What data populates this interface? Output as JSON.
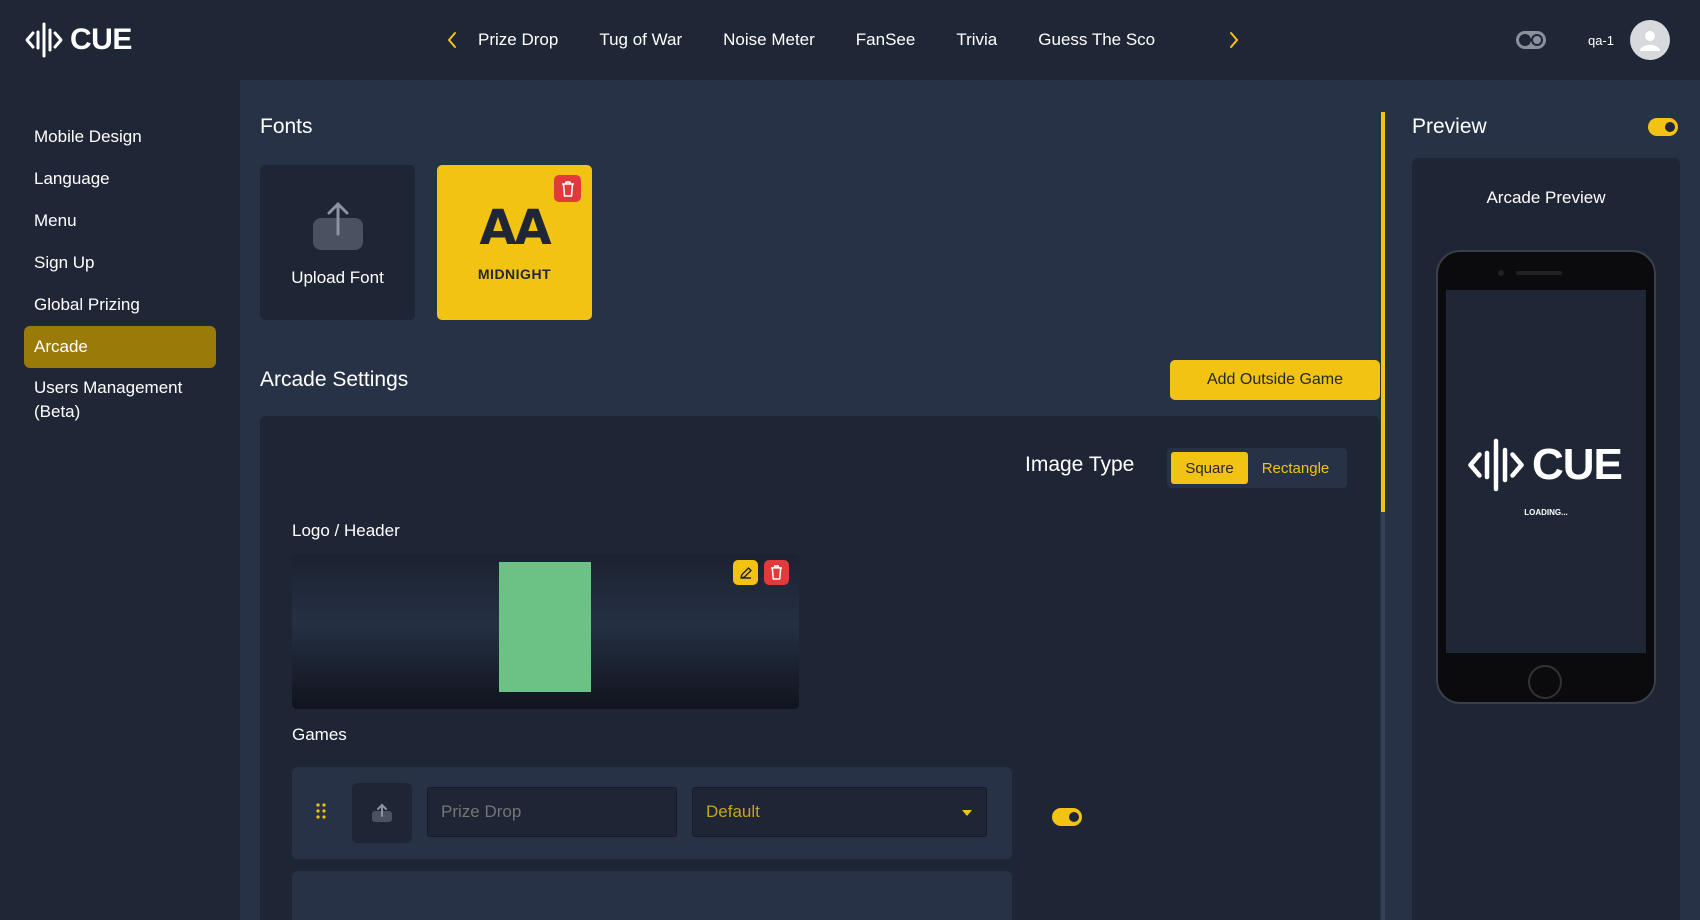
{
  "brand": {
    "name": "CUE"
  },
  "nav": {
    "items": [
      "Prize Drop",
      "Tug of War",
      "Noise Meter",
      "FanSee",
      "Trivia",
      "Guess The Sco"
    ]
  },
  "user": {
    "name": "qa-1"
  },
  "sidebar": {
    "items": [
      {
        "label": "Mobile Design",
        "active": false
      },
      {
        "label": "Language",
        "active": false
      },
      {
        "label": "Menu",
        "active": false
      },
      {
        "label": "Sign Up",
        "active": false
      },
      {
        "label": "Global Prizing",
        "active": false
      },
      {
        "label": "Arcade",
        "active": true
      },
      {
        "label": "Users Management",
        "label2": "(Beta)",
        "active": false
      }
    ]
  },
  "fonts": {
    "title": "Fonts",
    "upload_label": "Upload Font",
    "font_card": {
      "glyph": "AA",
      "name": "MIDNIGHT"
    }
  },
  "arcade": {
    "title": "Arcade Settings",
    "add_button": "Add Outside Game",
    "image_type_label": "Image Type",
    "image_type_options": [
      "Square",
      "Rectangle"
    ],
    "image_type_selected": "Square",
    "logo_header_label": "Logo / Header",
    "games_label": "Games",
    "games": [
      {
        "name_placeholder": "Prize Drop",
        "select_value": "Default",
        "enabled": true
      }
    ]
  },
  "preview": {
    "title": "Preview",
    "enabled": true,
    "name": "Arcade Preview",
    "phone_logo": "CUE",
    "loading_text": "LOADING..."
  },
  "colors": {
    "accent": "#f2c312",
    "background": "#1f2636",
    "panel": "#283246",
    "card": "#1e2534",
    "danger": "#e23a3a",
    "active_sidebar": "#9a7a08",
    "image_placeholder": "#6cc184"
  },
  "icons": [
    "cue-logo-icon",
    "chevron-left-icon",
    "chevron-right-icon",
    "theme-toggle-icon",
    "user-avatar-icon",
    "upload-icon",
    "trash-icon",
    "edit-pencil-icon",
    "drag-handle-icon",
    "caret-down-icon"
  ]
}
